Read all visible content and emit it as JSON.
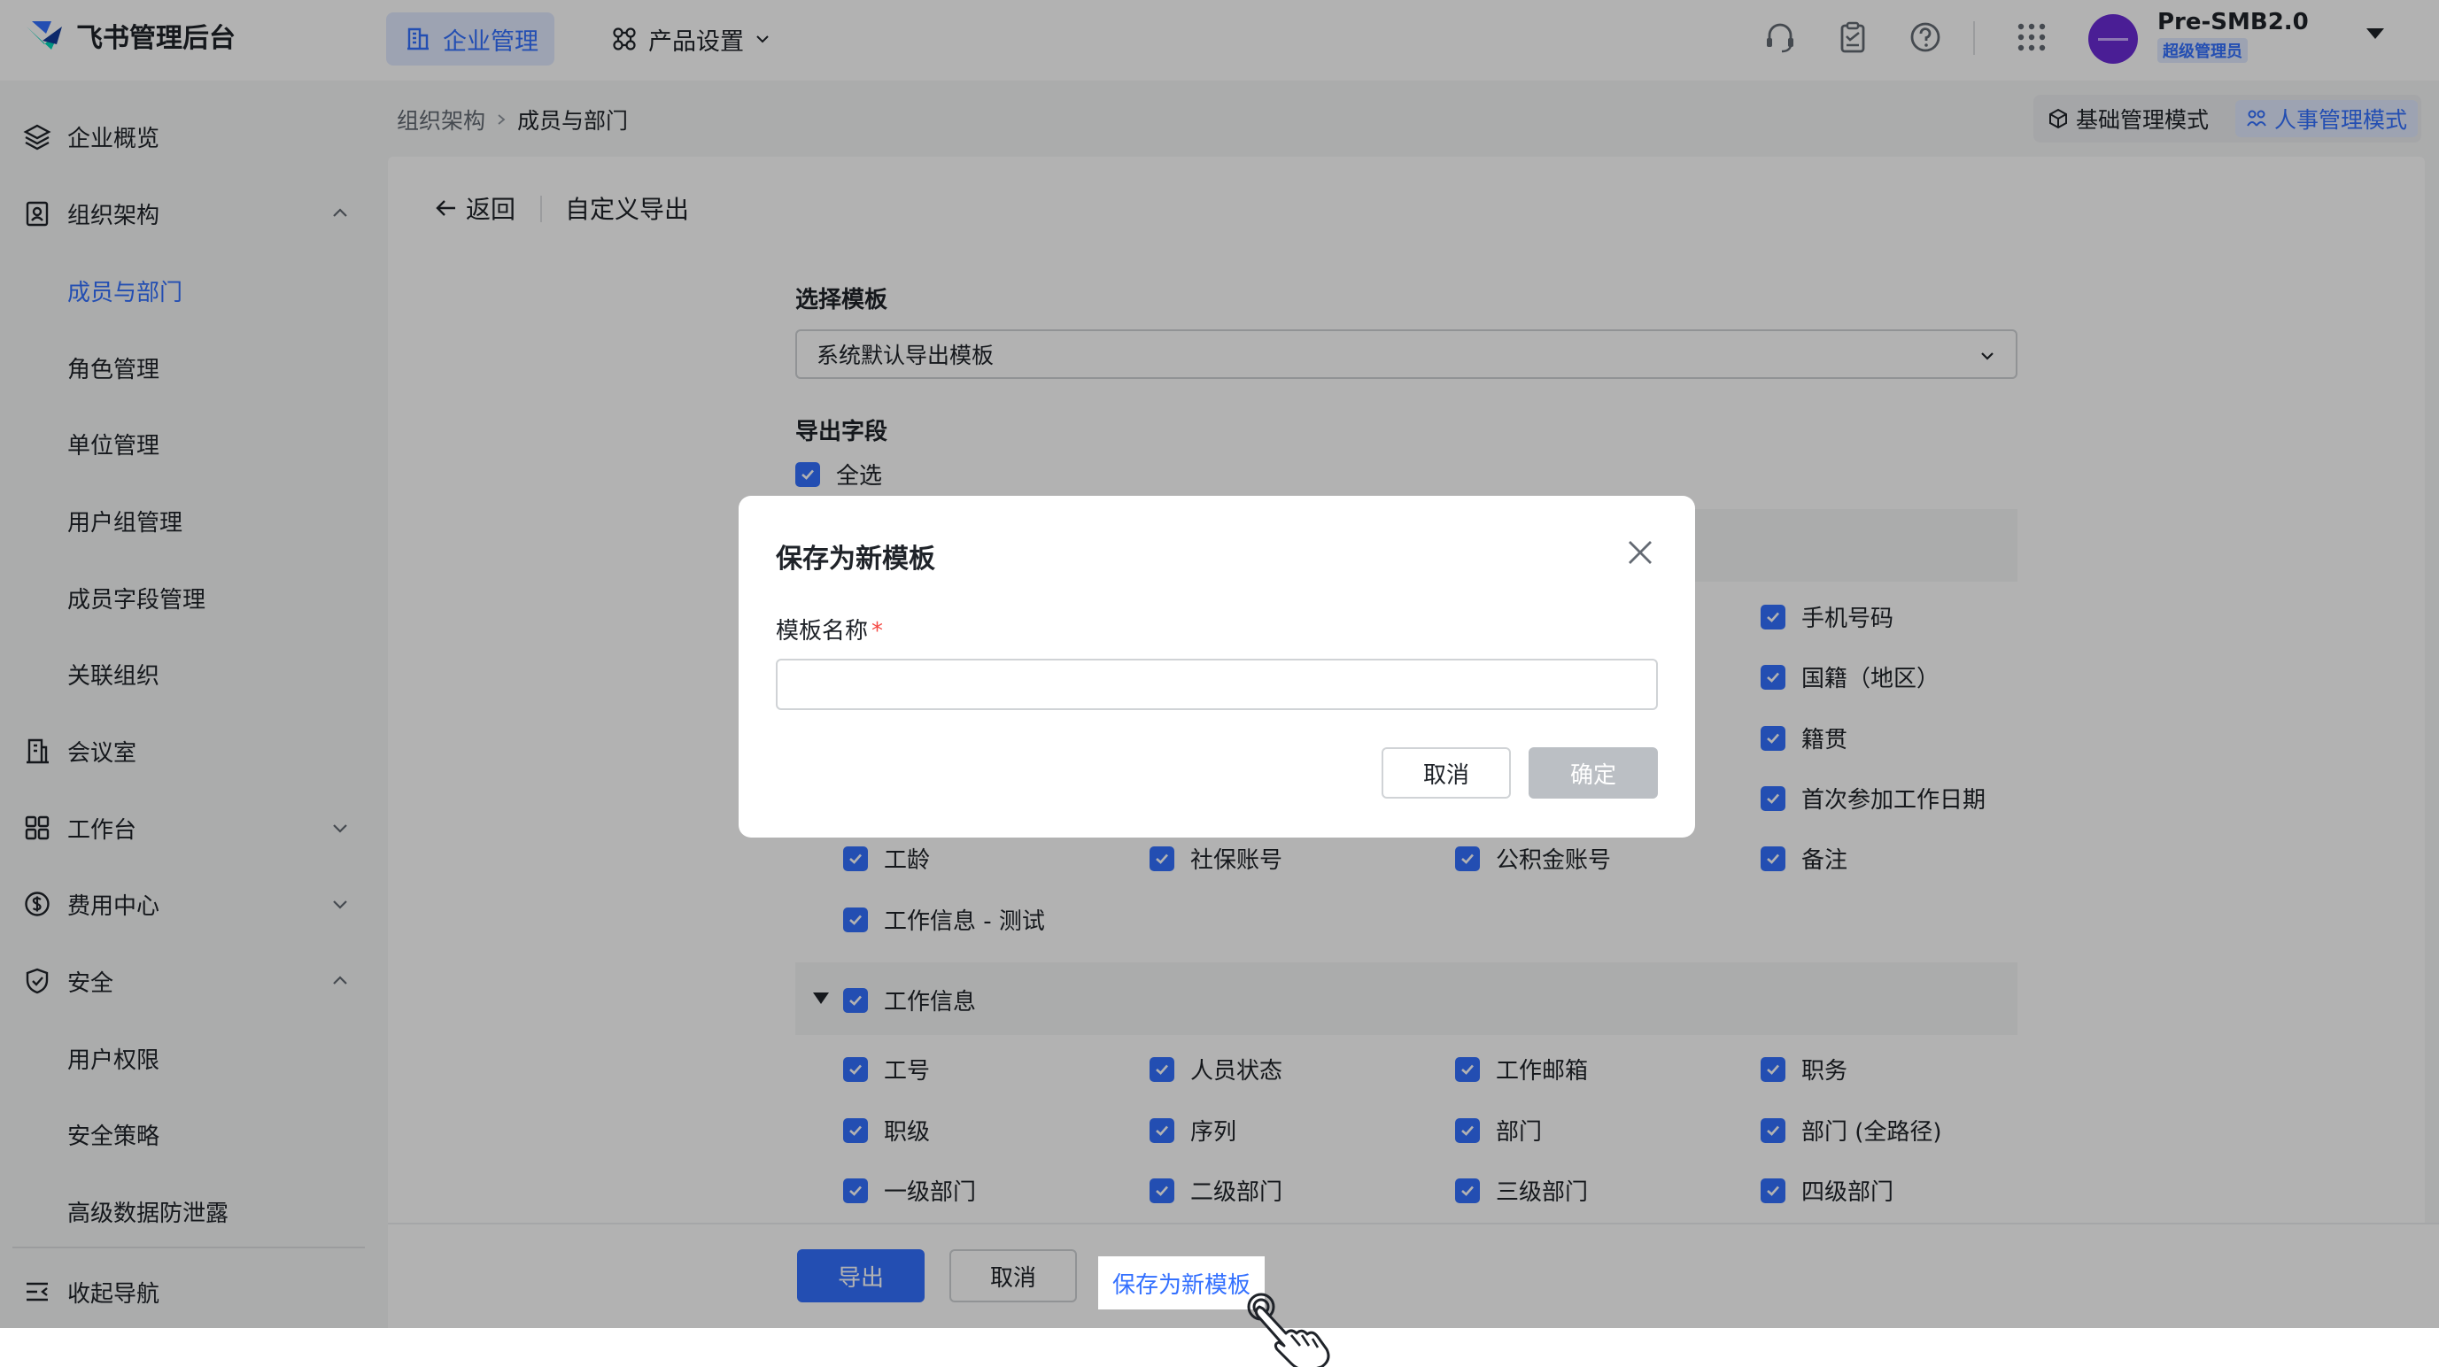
{
  "topbar": {
    "logo_text": "飞书管理后台",
    "nav_active_label": "企业管理",
    "nav_product_label": "产品设置",
    "icons": [
      "headset-icon",
      "clipboard-icon",
      "help-icon",
      "apps-grid-icon"
    ],
    "user_name": "Pre-SMB2.0",
    "user_role": "超级管理员"
  },
  "sidebar": {
    "items": [
      {
        "label": "企业概览",
        "icon": "layers-icon"
      },
      {
        "label": "组织架构",
        "icon": "org-icon"
      },
      {
        "label": "成员与部门"
      },
      {
        "label": "角色管理"
      },
      {
        "label": "单位管理"
      },
      {
        "label": "用户组管理"
      },
      {
        "label": "成员字段管理"
      },
      {
        "label": "关联组织"
      },
      {
        "label": "会议室",
        "icon": "building-icon"
      },
      {
        "label": "工作台",
        "icon": "workbench-icon"
      },
      {
        "label": "费用中心",
        "icon": "dollar-icon"
      },
      {
        "label": "安全",
        "icon": "shield-icon"
      },
      {
        "label": "用户权限"
      },
      {
        "label": "安全策略"
      },
      {
        "label": "高级数据防泄露"
      }
    ],
    "collapse_label": "收起导航"
  },
  "breadcrumb": {
    "parent": "组织架构",
    "current": "成员与部门"
  },
  "modes": {
    "basic": "基础管理模式",
    "hr": "人事管理模式"
  },
  "page": {
    "back_label": "返回",
    "title": "自定义导出",
    "template_label": "选择模板",
    "template_value": "系统默认导出模板",
    "fields_label": "导出字段",
    "select_all_label": "全选"
  },
  "fields": {
    "visible_right": [
      "手机号码",
      "国籍（地区）",
      "籍贯",
      "首次参加工作日期"
    ],
    "row_a": [
      "工龄",
      "社保账号",
      "公积金账号",
      "备注"
    ],
    "row_b": [
      "工作信息 - 测试"
    ],
    "work_group_label": "工作信息",
    "work_rows": [
      [
        "工号",
        "人员状态",
        "工作邮箱",
        "职务"
      ],
      [
        "职级",
        "序列",
        "部门",
        "部门 (全路径)"
      ],
      [
        "一级部门",
        "二级部门",
        "三级部门",
        "四级部门"
      ]
    ]
  },
  "footer": {
    "export_label": "导出",
    "cancel_label": "取消",
    "save_template_label": "保存为新模板"
  },
  "modal": {
    "title": "保存为新模板",
    "name_label": "模板名称",
    "required_mark": "*",
    "name_value": "",
    "cancel_label": "取消",
    "ok_label": "确定"
  },
  "colors": {
    "accent": "#3370ff",
    "required": "#f54a45",
    "avatar": "#6b2cd6"
  }
}
